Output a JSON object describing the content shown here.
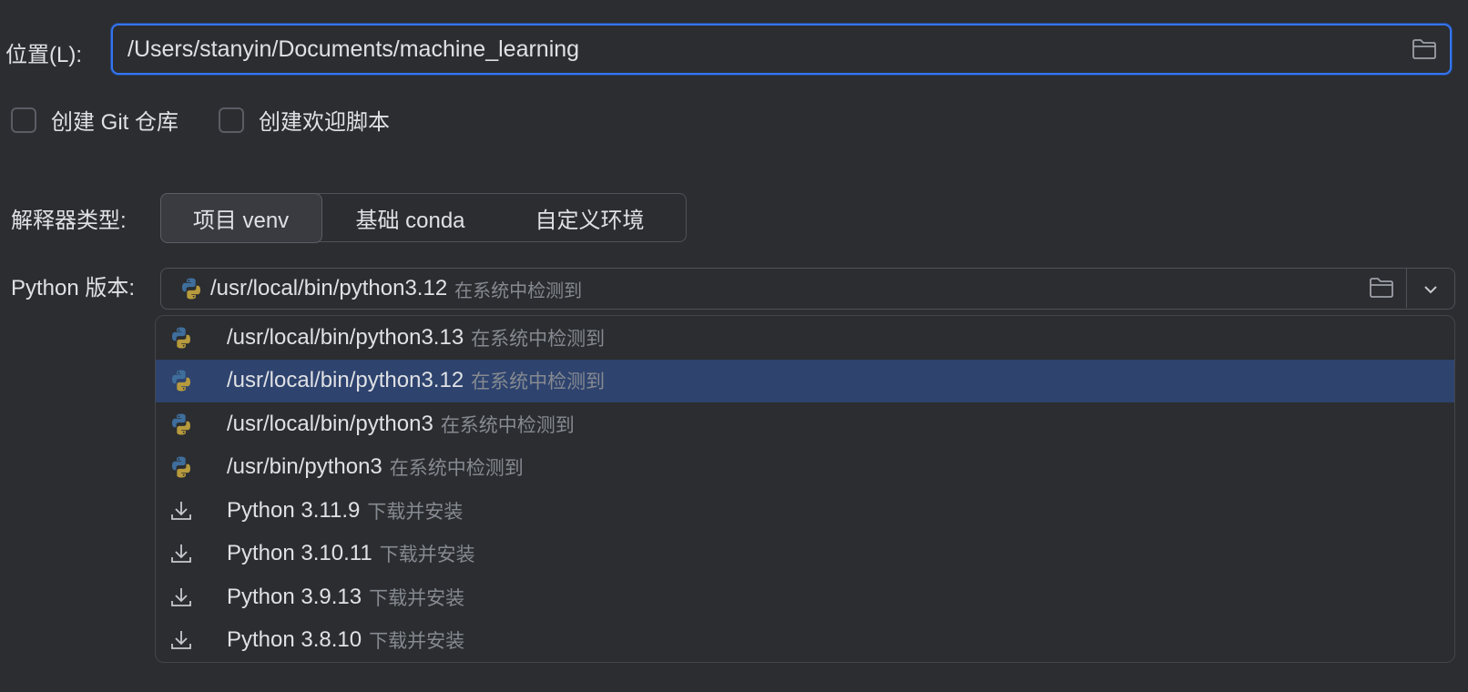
{
  "location": {
    "label": "位置(L):",
    "value": "/Users/stanyin/Documents/machine_learning",
    "browse_icon": "folder-icon"
  },
  "options": {
    "git_repo": {
      "label": "创建 Git 仓库",
      "checked": false
    },
    "welcome_script": {
      "label": "创建欢迎脚本",
      "checked": false
    }
  },
  "interpreter": {
    "label": "解释器类型:",
    "types": [
      "项目 venv",
      "基础 conda",
      "自定义环境"
    ],
    "selected": "项目 venv"
  },
  "python_version": {
    "label": "Python 版本:",
    "selected_path": "/usr/local/bin/python3.12",
    "selected_hint": "在系统中检测到",
    "browse_icon": "folder-icon",
    "dropdown_icon": "chevron-down-icon"
  },
  "dropdown": {
    "items": [
      {
        "text": "/usr/local/bin/python3.13",
        "hint": "在系统中检测到",
        "icon": "python-icon",
        "selected": false
      },
      {
        "text": "/usr/local/bin/python3.12",
        "hint": "在系统中检测到",
        "icon": "python-icon",
        "selected": true
      },
      {
        "text": "/usr/local/bin/python3",
        "hint": "在系统中检测到",
        "icon": "python-icon",
        "selected": false
      },
      {
        "text": "/usr/bin/python3",
        "hint": "在系统中检测到",
        "icon": "python-icon",
        "selected": false
      },
      {
        "text": "Python 3.11.9",
        "hint": "下载并安装",
        "icon": "download-icon",
        "selected": false
      },
      {
        "text": "Python 3.10.11",
        "hint": "下载并安装",
        "icon": "download-icon",
        "selected": false
      },
      {
        "text": "Python 3.9.13",
        "hint": "下载并安装",
        "icon": "download-icon",
        "selected": false
      },
      {
        "text": "Python 3.8.10",
        "hint": "下载并安装",
        "icon": "download-icon",
        "selected": false
      }
    ]
  },
  "colors": {
    "background": "#2b2d30",
    "accent": "#3574f0",
    "selected_row": "#2e436e",
    "hint_text": "#868a91"
  }
}
